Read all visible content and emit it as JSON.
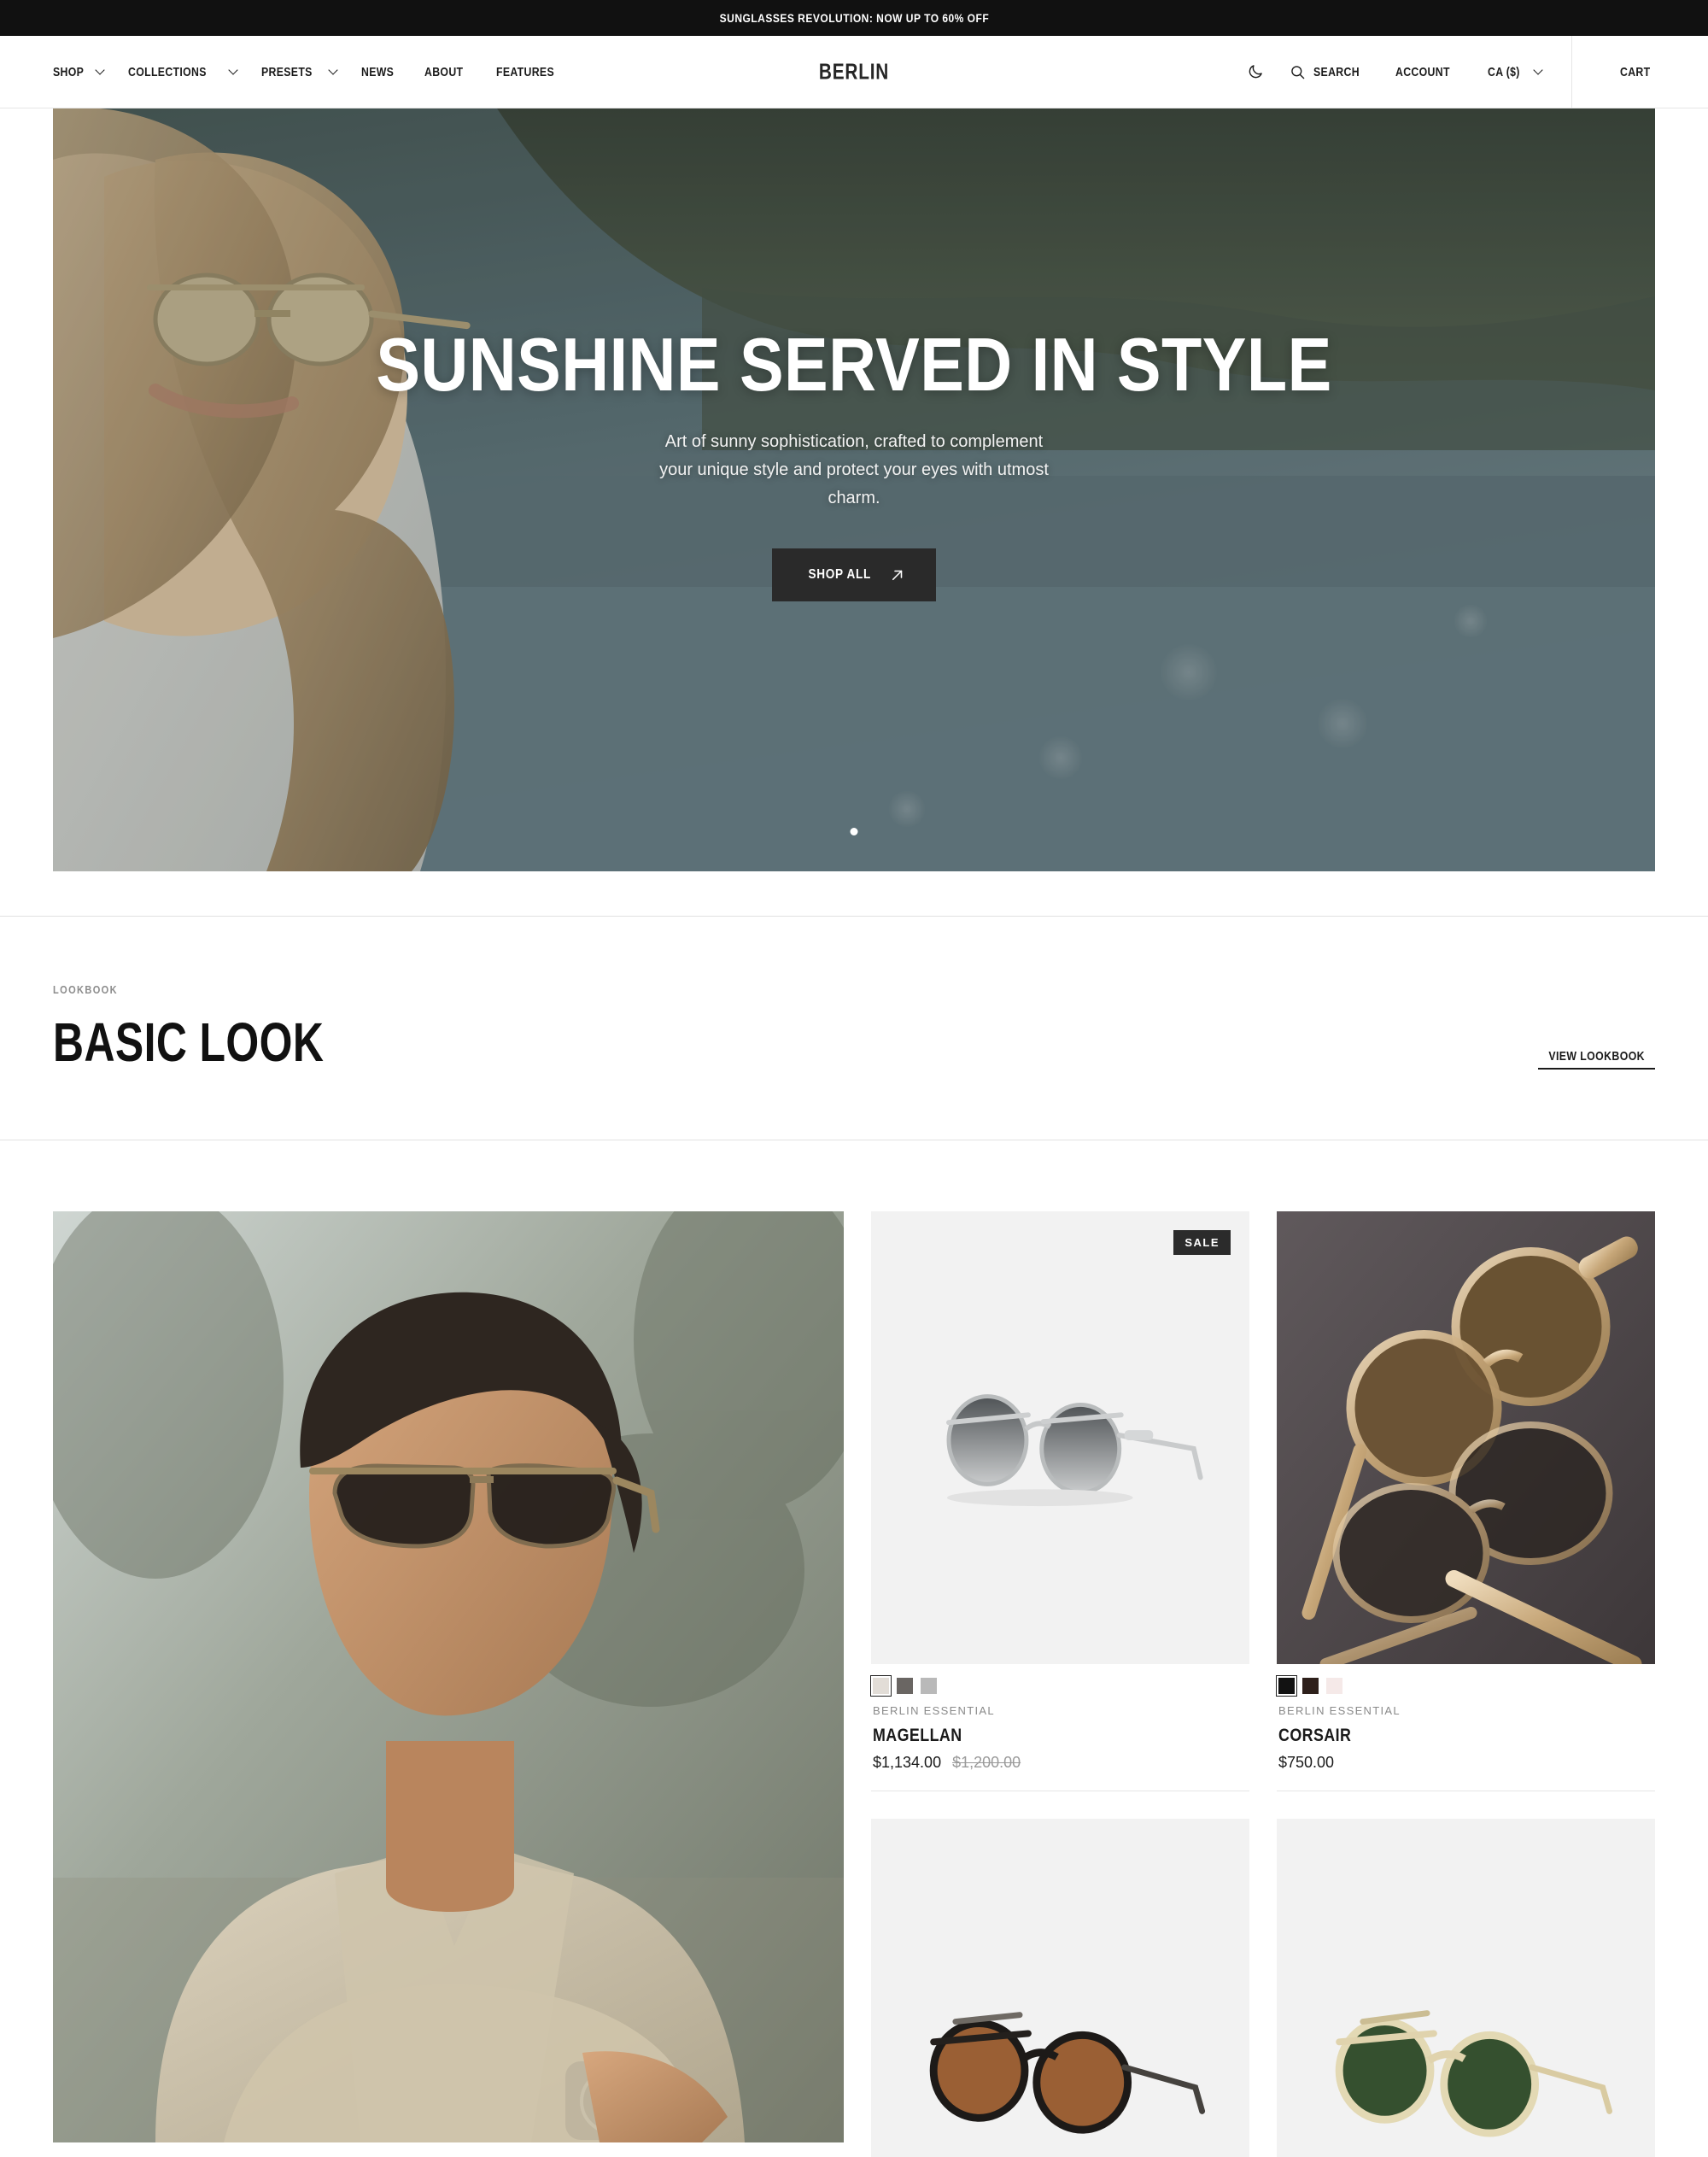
{
  "announcement": {
    "text": "SUNGLASSES REVOLUTION: NOW UP TO 60% OFF"
  },
  "header": {
    "brand": "BERLIN",
    "nav": [
      {
        "label": "SHOP",
        "has_chevron": true
      },
      {
        "label": "COLLECTIONS",
        "has_chevron": true
      },
      {
        "label": "PRESETS",
        "has_chevron": true
      },
      {
        "label": "NEWS",
        "has_chevron": false
      },
      {
        "label": "ABOUT",
        "has_chevron": false
      },
      {
        "label": "FEATURES",
        "has_chevron": false
      }
    ],
    "theme_toggle_icon": "moon-icon",
    "search_icon": "search-icon",
    "search_label": "SEARCH",
    "account_label": "ACCOUNT",
    "currency_label": "CA ($)",
    "cart_label": "CART"
  },
  "hero": {
    "title": "SUNSHINE SERVED IN STYLE",
    "subtitle": "Art of sunny sophistication, crafted to complement your unique style and protect your eyes with utmost charm.",
    "cta_label": "SHOP ALL",
    "cta_icon": "arrow-up-right-icon",
    "slide_count": 1,
    "active_slide": 1
  },
  "lookbook": {
    "eyebrow": "LOOKBOOK",
    "title": "BASIC LOOK",
    "link_label": "VIEW LOOKBOOK"
  },
  "products": [
    {
      "vendor": "BERLIN ESSENTIAL",
      "title": "MAGELLAN",
      "price": "$1,134.00",
      "compare_at_price": "$1,200.00",
      "badge": "SALE",
      "swatches": [
        "#e2ddd7",
        "#6a6663",
        "#b9b9b9"
      ],
      "selected_swatch": 0
    },
    {
      "vendor": "BERLIN ESSENTIAL",
      "title": "CORSAIR",
      "price": "$750.00",
      "compare_at_price": "",
      "badge": "",
      "swatches": [
        "#121212",
        "#2e201b",
        "#f5e9e8"
      ],
      "selected_swatch": 0
    }
  ],
  "colors": {
    "accent": "#111111",
    "badge_bg": "#2b2b2b",
    "muted_text": "#8a8a8a",
    "border": "#e6e6e6"
  }
}
